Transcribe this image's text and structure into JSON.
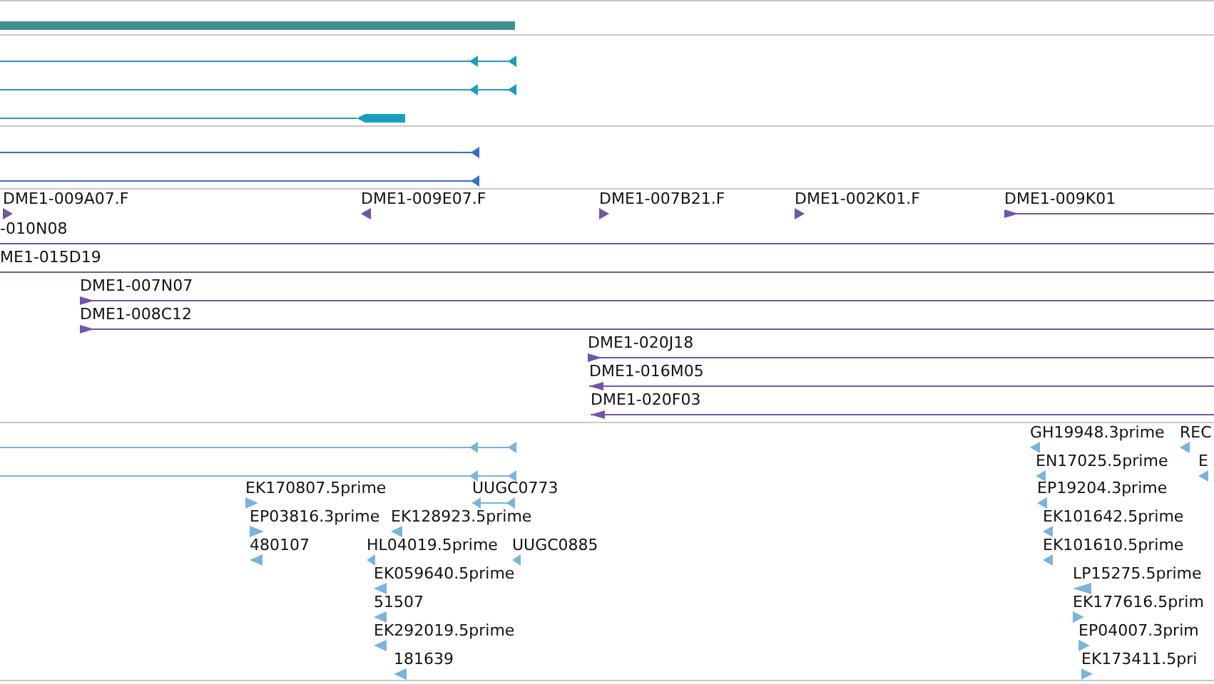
{
  "tracks": [
    {
      "kind": "gene",
      "color": "#3f8f8f"
    },
    {
      "kind": "transcript",
      "color": "#1a9ec0",
      "features": [
        {
          "reverse": true
        },
        {
          "reverse": true
        },
        {
          "reverse": true
        }
      ]
    },
    {
      "kind": "transcript",
      "color": "#3a6cc8",
      "features": [
        {
          "reverse": true
        },
        {
          "reverse": true
        }
      ]
    },
    {
      "kind": "clone",
      "color": "#7055a8",
      "features": [
        {
          "label": "DME1-009A07.F",
          "reverse": false
        },
        {
          "label": "DME1-009E07.F",
          "reverse": true
        },
        {
          "label": "DME1-007B21.F",
          "reverse": false
        },
        {
          "label": "DME1-002K01.F",
          "reverse": false
        },
        {
          "label": "DME1-009K01",
          "reverse": false
        },
        {
          "label": "-010N08"
        },
        {
          "label": "ME1-015D19"
        },
        {
          "label": "DME1-007N07",
          "reverse": false
        },
        {
          "label": "DME1-008C12",
          "reverse": false
        },
        {
          "label": "DME1-020J18",
          "reverse": false
        },
        {
          "label": "DME1-016M05",
          "reverse": true
        },
        {
          "label": "DME1-020F03",
          "reverse": true
        }
      ]
    },
    {
      "kind": "est",
      "color": "#7ab4dc",
      "features": [
        {
          "reverse": true
        },
        {
          "reverse": true
        },
        {
          "label": "GH19948.3prime",
          "reverse": true
        },
        {
          "label": "REC",
          "reverse": true
        },
        {
          "label": "EN17025.5prime",
          "reverse": true
        },
        {
          "label": "E",
          "reverse": true
        },
        {
          "label": "EK170807.5prime",
          "reverse": false
        },
        {
          "label": "UUGC0773",
          "reverse": true
        },
        {
          "label": "EP19204.3prime",
          "reverse": true
        },
        {
          "label": "EP03816.3prime",
          "reverse": false
        },
        {
          "label": "EK128923.5prime",
          "reverse": true
        },
        {
          "label": "EK101642.5prime",
          "reverse": true
        },
        {
          "label": "480107",
          "reverse": true
        },
        {
          "label": "HL04019.5prime",
          "reverse": true
        },
        {
          "label": "UUGC0885",
          "reverse": true
        },
        {
          "label": "EK101610.5prime",
          "reverse": true
        },
        {
          "label": "EK059640.5prime",
          "reverse": true
        },
        {
          "label": "LP15275.5prime",
          "reverse": true
        },
        {
          "label": "51507",
          "reverse": true
        },
        {
          "label": "EK177616.5prim",
          "reverse": false
        },
        {
          "label": "EK292019.5prime",
          "reverse": true
        },
        {
          "label": "EP04007.3prim",
          "reverse": false
        },
        {
          "label": "181639",
          "reverse": true
        },
        {
          "label": "EK173411.5pri",
          "reverse": false
        }
      ]
    }
  ]
}
